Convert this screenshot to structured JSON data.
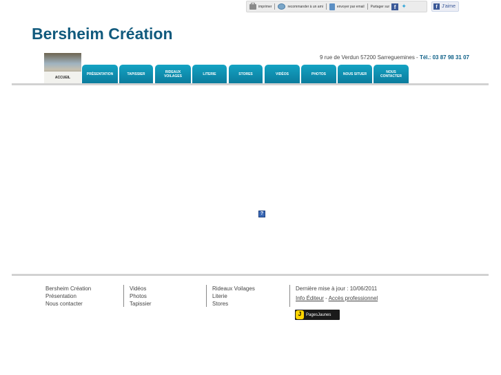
{
  "toolbar": {
    "print": "imprimer",
    "recommend": "recommander à un ami",
    "email": "envoyer par email",
    "share": "Partager sur",
    "like": "J'aime"
  },
  "header": {
    "site_title": "Bersheim Création",
    "address": "9 rue de Verdun 57200 Sarreguemines",
    "address_sep": " - ",
    "tel": "Tél.: 03 87 98 31 07"
  },
  "nav": {
    "tabs": [
      {
        "label": "ACCUEIL",
        "active": true
      },
      {
        "label": "PRÉSENTATION"
      },
      {
        "label": "TAPISSIER"
      },
      {
        "label": "RIDEAUX VOILAGES"
      },
      {
        "label": "LITERIE"
      },
      {
        "label": "STORES"
      },
      {
        "label": "VIDÉOS"
      },
      {
        "label": "PHOTOS"
      },
      {
        "label": "NOUS SITUER"
      },
      {
        "label": "NOUS CONTACTER"
      }
    ]
  },
  "main": {
    "help_icon": "?"
  },
  "footer": {
    "col1": [
      "Bersheim Création",
      "Présentation",
      "Nous contacter"
    ],
    "col2": [
      "Vidéos",
      "Photos",
      "Tapissier"
    ],
    "col3": [
      "Rideaux Voilages",
      "Literie",
      "Stores"
    ],
    "last_update": "Dernière mise à jour : 10/06/2011",
    "info_editeur": "Info Éditeur",
    "link_sep": " - ",
    "acces_pro": "Accès professionnel",
    "badge_logo": "J",
    "badge_text": "PagesJaunes"
  },
  "colors": {
    "title": "#115a7d",
    "tab": "#0b7c9d",
    "tel": "#0b5e86"
  }
}
